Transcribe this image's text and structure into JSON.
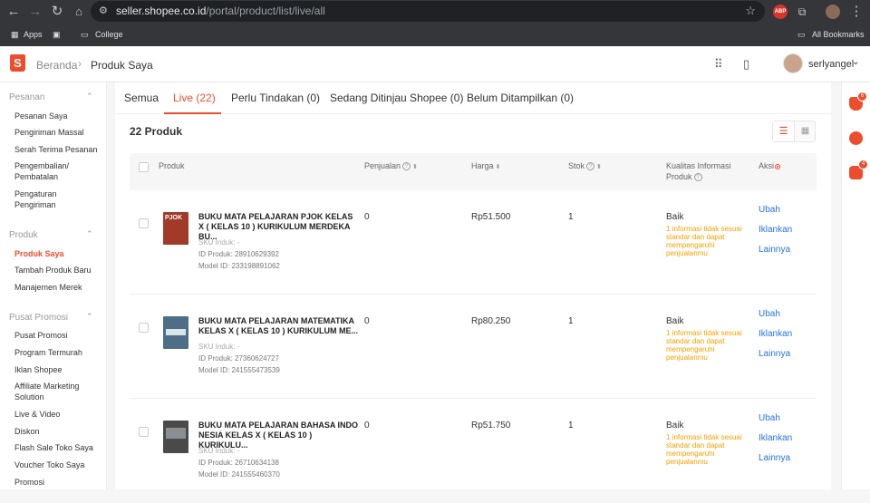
{
  "browser": {
    "url_host": "seller.shopee.co.id",
    "url_path": "/portal/product/list/live/all",
    "bookmarks": [
      "Apps",
      "College",
      "All Bookmarks"
    ],
    "extension_label": "ABP"
  },
  "header": {
    "logo_letter": "S",
    "breadcrumb_home": "Beranda",
    "breadcrumb_current": "Produk Saya",
    "username": "serlyangel"
  },
  "sidebar": {
    "sections": [
      {
        "title": "Pesanan",
        "items": [
          "Pesanan Saya",
          "Pengiriman Massal",
          "Serah Terima Pesanan",
          "Pengembalian/ Pembatalan",
          "Pengaturan Pengiriman"
        ]
      },
      {
        "title": "Produk",
        "items": [
          "Produk Saya",
          "Tambah Produk Baru",
          "Manajemen Merek"
        ]
      },
      {
        "title": "Pusat Promosi",
        "items": [
          "Pusat Promosi",
          "Program Termurah",
          "Iklan Shopee",
          "Affiliate Marketing Solution",
          "Live & Video",
          "Diskon",
          "Flash Sale Toko Saya",
          "Voucher Toko Saya",
          "Promosi"
        ]
      }
    ],
    "active_item": "Produk Saya"
  },
  "tabs": [
    "Semua",
    "Live (22)",
    "Perlu Tindakan (0)",
    "Sedang Ditinjau Shopee (0)",
    "Belum Ditampilkan (0)"
  ],
  "active_tab": "Live (22)",
  "product_count": "22 Produk",
  "table": {
    "headers": {
      "product": "Produk",
      "sales": "Penjualan",
      "price": "Harga",
      "stock": "Stok",
      "quality_line1": "Kualitas Informasi",
      "quality_line2": "Produk",
      "actions": "Aksi"
    },
    "rows": [
      {
        "name": "BUKU MATA PELAJARAN PJOK KELAS X ( KELAS 10 ) KURIKULUM MERDEKA BU...",
        "sku": "SKU Induk: -",
        "product_id": "ID Produk: 28910629392",
        "model_id": "Model ID: 233198891062",
        "sales": "0",
        "price": "Rp51.500",
        "stock": "1",
        "quality": "Baik",
        "quality_note": "1 informasi tidak sesuai standar dan dapat mempengaruhi penjualanmu",
        "thumb_color": "#a23a2a"
      },
      {
        "name": "BUKU MATA PELAJARAN MATEMATIKA KELAS X ( KELAS 10 ) KURIKULUM ME...",
        "sku": "SKU Induk: -",
        "product_id": "ID Produk: 27360624727",
        "model_id": "Model ID: 241555473539",
        "sales": "0",
        "price": "Rp80.250",
        "stock": "1",
        "quality": "Baik",
        "quality_note": "1 informasi tidak sesuai standar dan dapat mempengaruhi penjualanmu",
        "thumb_color": "#4e6e86"
      },
      {
        "name": "BUKU MATA PELAJARAN BAHASA INDO NESIA KELAS X ( KELAS 10 ) KURIKULU...",
        "sku": "SKU Induk: -",
        "product_id": "ID Produk: 26710634138",
        "model_id": "Model ID: 241555460370",
        "sales": "0",
        "price": "Rp51.750",
        "stock": "1",
        "quality": "Baik",
        "quality_note": "1 informasi tidak sesuai standar dan dapat mempengaruhi penjualanmu",
        "thumb_color": "#4a4a4a"
      }
    ],
    "actions": [
      "Ubah",
      "Iklankan",
      "Lainnya"
    ]
  },
  "right_bar": {
    "notification_badge": "6",
    "chat_badge": "4"
  },
  "colors": {
    "brand": "#ee4d2d",
    "link": "#2673dd",
    "warning": "#f6a000"
  }
}
